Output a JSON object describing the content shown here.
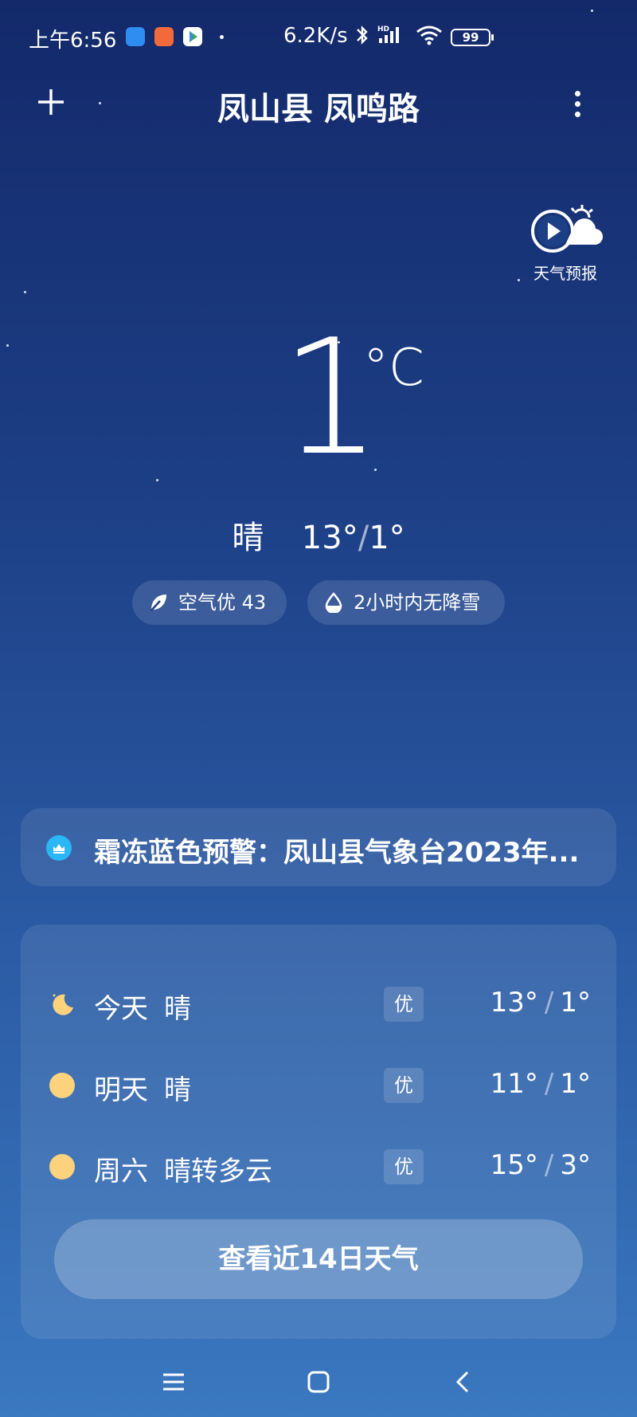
{
  "status_bar": {
    "time": "上午6:56",
    "net_speed": "6.2K/s",
    "signal_badge": "HD",
    "battery": "99"
  },
  "header": {
    "title": "凤山县 凤鸣路"
  },
  "forecast_video": {
    "label": "天气预报"
  },
  "current": {
    "temp": "1",
    "unit": "°C",
    "condition": "晴",
    "high": "13°",
    "low": "1°",
    "separator": "/"
  },
  "pills": {
    "air_quality": "空气优 43",
    "precip": "2小时内无降雪"
  },
  "alert": {
    "text": "霜冻蓝色预警：凤山县气象台2023年..."
  },
  "forecast": {
    "days": [
      {
        "day": "今天",
        "condition": "晴",
        "aqi": "优",
        "high": "13°",
        "low": "1°",
        "icon": "moon-icon"
      },
      {
        "day": "明天",
        "condition": "晴",
        "aqi": "优",
        "high": "11°",
        "low": "1°",
        "icon": "sun-icon"
      },
      {
        "day": "周六",
        "condition": "晴转多云",
        "aqi": "优",
        "high": "15°",
        "low": "3°",
        "icon": "sun-icon"
      }
    ],
    "sep": "/",
    "button_label": "查看近14日天气"
  },
  "colors": {
    "sun": "#fcd27c",
    "alert_blue": "#2ab7f5"
  }
}
